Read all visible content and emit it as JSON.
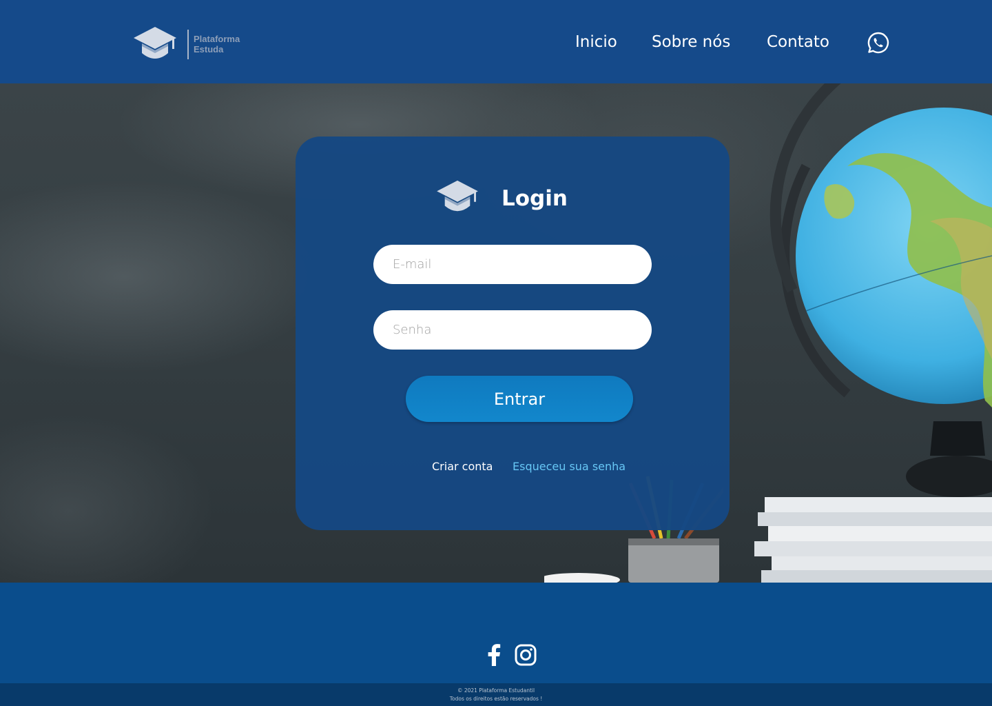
{
  "header": {
    "logo_line1": "Plataforma",
    "logo_line2": "Estuda",
    "logo_icon": "graduation-cap-icon",
    "nav": [
      {
        "label": "Inicio"
      },
      {
        "label": "Sobre nós"
      },
      {
        "label": "Contato"
      }
    ],
    "contact_icon": "whatsapp-icon"
  },
  "login": {
    "icon": "graduation-cap-icon",
    "title": "Login",
    "email_placeholder": "E-mail",
    "password_placeholder": "Senha",
    "submit_label": "Entrar",
    "create_account_label": "Criar conta",
    "forgot_password_label": "Esqueceu sua senha"
  },
  "footer": {
    "social": [
      {
        "icon": "facebook-icon"
      },
      {
        "icon": "instagram-icon"
      }
    ],
    "copyright_line1": "© 2021 Plataforma Estudantil",
    "copyright_line2": "Todos os direitos estão reservados !"
  },
  "colors": {
    "header_bg": "#154a8a",
    "footer_bg": "#0a4d8c",
    "bottom_bar_bg": "#083a6a",
    "card_bg": "#164882",
    "button_bg": "#0f7abf",
    "link_accent": "#67c7f5"
  }
}
